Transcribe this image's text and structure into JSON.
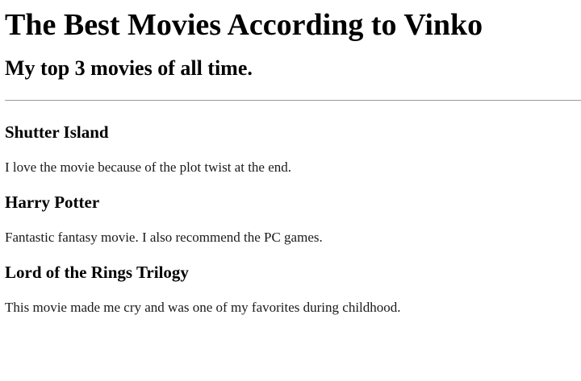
{
  "header": {
    "title": "The Best Movies According to Vinko",
    "subtitle": "My top 3 movies of all time."
  },
  "movies": [
    {
      "title": "Shutter Island",
      "description": "I love the movie because of the plot twist at the end."
    },
    {
      "title": "Harry Potter",
      "description": "Fantastic fantasy movie. I also recommend the PC games."
    },
    {
      "title": "Lord of the Rings Trilogy",
      "description": "This movie made me cry and was one of my favorites during childhood."
    }
  ]
}
